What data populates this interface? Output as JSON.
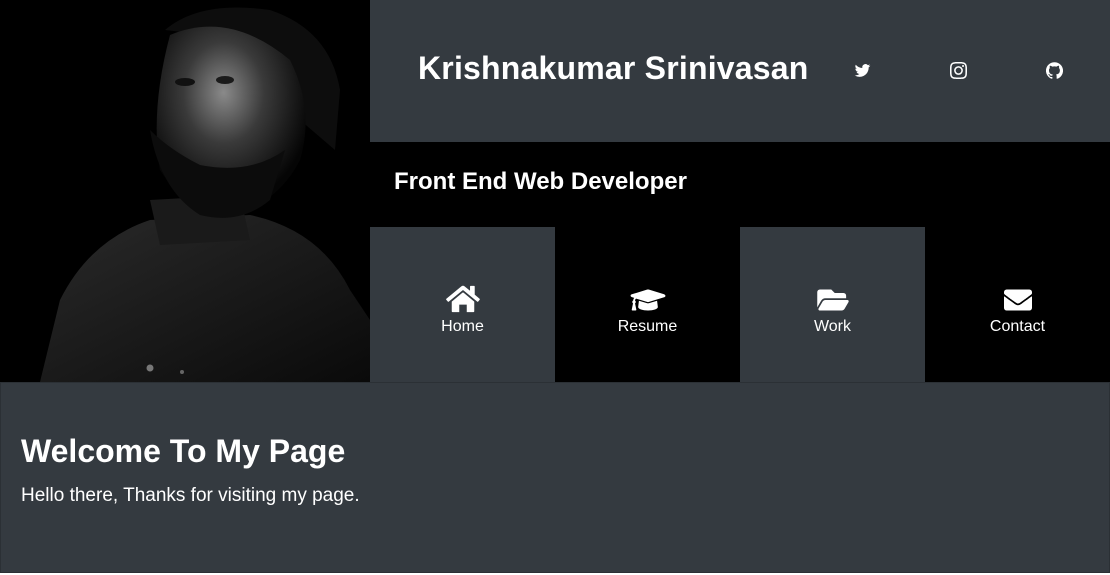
{
  "header": {
    "name": "Krishnakumar Srinivasan",
    "role": "Front End Web Developer",
    "social": [
      {
        "icon": "twitter-icon"
      },
      {
        "icon": "instagram-icon"
      },
      {
        "icon": "github-icon"
      }
    ]
  },
  "nav": [
    {
      "label": "Home",
      "icon": "home-icon"
    },
    {
      "label": "Resume",
      "icon": "graduation-cap-icon"
    },
    {
      "label": "Work",
      "icon": "folder-open-icon"
    },
    {
      "label": "Contact",
      "icon": "envelope-icon"
    }
  ],
  "welcome": {
    "title": "Welcome To My Page",
    "text": "Hello there, Thanks for visiting my page."
  },
  "colors": {
    "panel": "#343a40",
    "black": "#000000",
    "text": "#ffffff"
  }
}
